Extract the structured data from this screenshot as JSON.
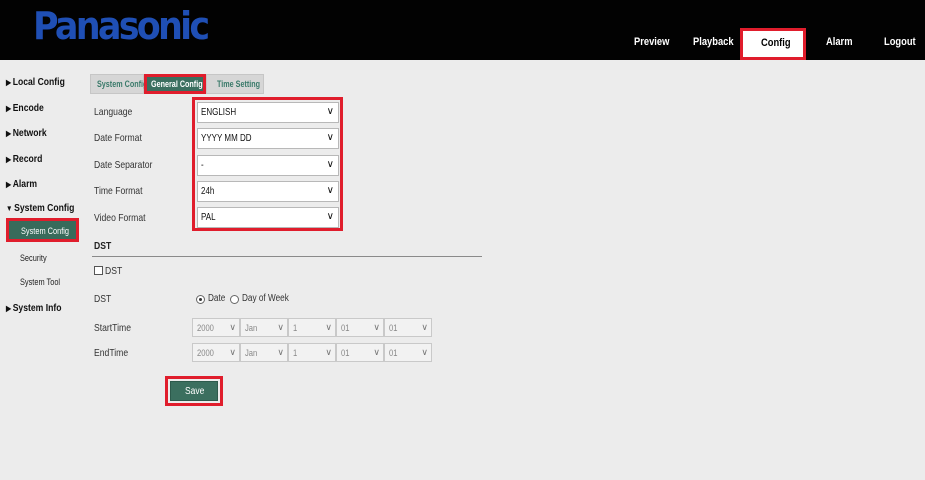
{
  "brand": {
    "logo_text": "Panasonic",
    "logo_color": "#1f4fb5"
  },
  "topnav": {
    "preview": "Preview",
    "playback": "Playback",
    "config": "Config",
    "alarm": "Alarm",
    "logout": "Logout"
  },
  "sidebar": {
    "local_config": "Local Config",
    "encode": "Encode",
    "network": "Network",
    "record": "Record",
    "alarm": "Alarm",
    "system_config": "System Config",
    "sub_system_config": "System Config",
    "sub_security": "Security",
    "sub_system_tool": "System Tool",
    "system_info": "System Info"
  },
  "tabs": {
    "system_config": "System Config",
    "general_config": "General Config",
    "time_setting": "Time Setting"
  },
  "form": {
    "language_label": "Language",
    "language_value": "ENGLISH",
    "date_format_label": "Date Format",
    "date_format_value": "YYYY MM DD",
    "date_separator_label": "Date Separator",
    "date_separator_value": "-",
    "time_format_label": "Time Format",
    "time_format_value": "24h",
    "video_format_label": "Video Format",
    "video_format_value": "PAL"
  },
  "dst": {
    "section_title": "DST",
    "checkbox_label": "DST",
    "mode_label": "DST",
    "mode_date": "Date",
    "mode_day_of_week": "Day of Week",
    "start_label": "StartTime",
    "end_label": "EndTime",
    "start": {
      "year": "2000",
      "month": "Jan",
      "day": "1",
      "hour": "01",
      "minute": "01"
    },
    "end": {
      "year": "2000",
      "month": "Jan",
      "day": "1",
      "hour": "01",
      "minute": "01"
    }
  },
  "actions": {
    "save": "Save"
  },
  "colors": {
    "accent_green": "#3b6f5f",
    "highlight_red": "#e01d2c"
  }
}
